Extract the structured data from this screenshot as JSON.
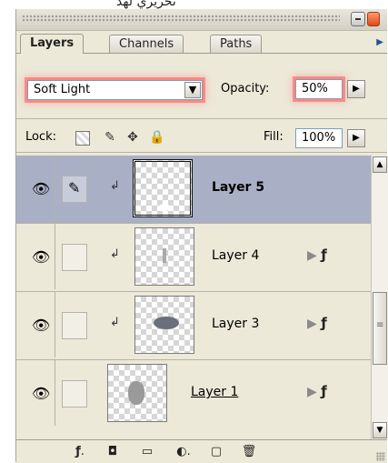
{
  "window": {
    "top_text": "تحريري لهد"
  },
  "tabs": [
    {
      "label": "Layers",
      "active": true
    },
    {
      "label": "Channels",
      "active": false
    },
    {
      "label": "Paths",
      "active": false
    }
  ],
  "blend": {
    "mode": "Soft Light",
    "opacity_label": "Opacity:",
    "opacity_value": "50%"
  },
  "lock": {
    "label": "Lock:",
    "fill_label": "Fill:",
    "fill_value": "100%"
  },
  "layers": [
    {
      "name": "Layer 5",
      "selected": true,
      "clipped": true,
      "fx": false
    },
    {
      "name": "Layer 4",
      "selected": false,
      "clipped": true,
      "fx": true
    },
    {
      "name": "Layer 3",
      "selected": false,
      "clipped": true,
      "fx": true
    },
    {
      "name": "Layer 1",
      "selected": false,
      "clipped": false,
      "fx": true
    }
  ],
  "colors": {
    "panel_bg": "#ece9d8",
    "selected_row": "#a9b0c6",
    "highlight": "#ff5a5a"
  },
  "icons": {
    "visibility": "eye-icon",
    "brush": "brush-icon",
    "effects": "fx-icon",
    "trash": "trash-icon"
  }
}
